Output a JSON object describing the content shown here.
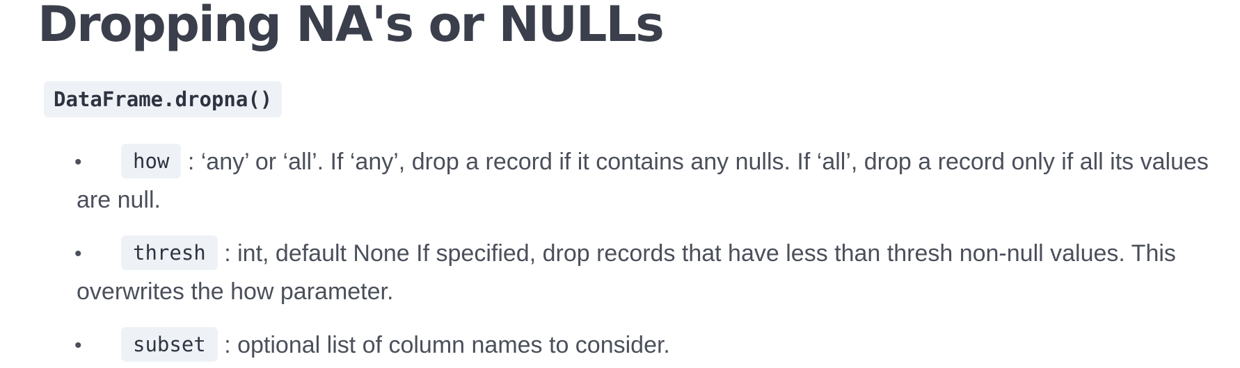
{
  "page": {
    "title": "Dropping NA's or NULLs"
  },
  "method": {
    "signature": "DataFrame.dropna()"
  },
  "params": [
    {
      "name": "how",
      "description": " : ‘any’ or ‘all’. If ‘any’, drop a record if it contains any nulls. If ‘all’, drop a record only if all its values are null."
    },
    {
      "name": "thresh",
      "description": " : int, default None If specified, drop records that have less than thresh non-null values. This overwrites the how parameter."
    },
    {
      "name": "subset",
      "description": " : optional list of column names to consider."
    }
  ],
  "colors": {
    "text": "#3a3f4b",
    "code_background": "#eef2f6"
  }
}
